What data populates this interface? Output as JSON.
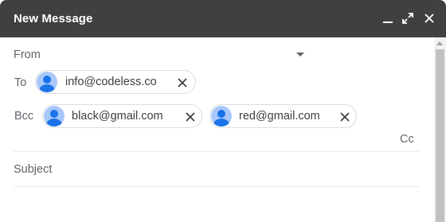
{
  "window": {
    "title": "New Message"
  },
  "compose": {
    "from_label": "From",
    "to_label": "To",
    "bcc_label": "Bcc",
    "cc_label": "Cc",
    "subject_placeholder": "Subject",
    "to_recipients": [
      {
        "email": "info@codeless.co"
      }
    ],
    "bcc_recipients": [
      {
        "email": "black@gmail.com"
      },
      {
        "email": "red@gmail.com"
      }
    ]
  },
  "icons": {
    "minimize": "minimize-icon",
    "expand": "expand-icon",
    "close": "close-icon",
    "avatar": "person-avatar-icon",
    "remove": "remove-chip-icon",
    "dropdown": "caret-down-icon"
  },
  "colors": {
    "titlebar": "#404040",
    "avatar_bg": "#a8c7fa",
    "avatar_fg": "#1a73e8"
  }
}
